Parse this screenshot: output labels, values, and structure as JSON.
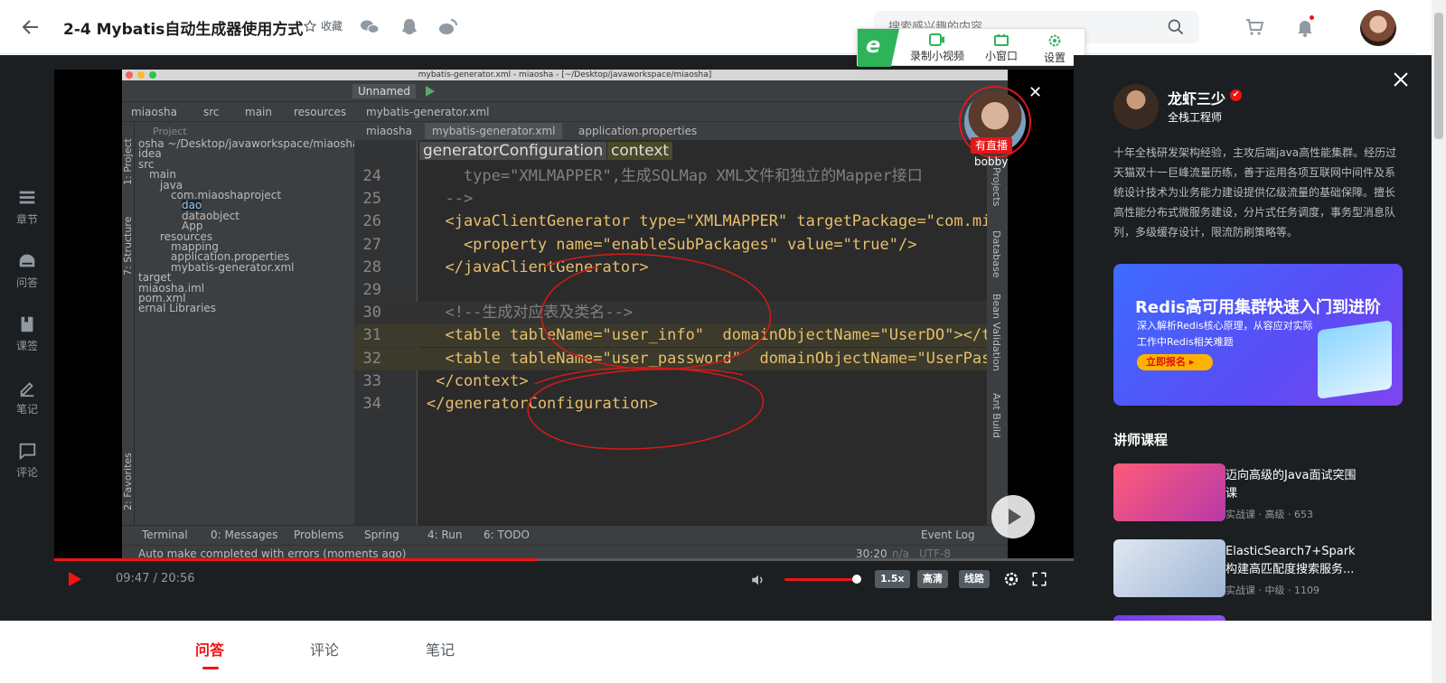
{
  "header": {
    "title": "2-4 Mybatis自动生成器使用方式",
    "favorite_label": "收藏",
    "search_placeholder": "搜索感兴趣的内容"
  },
  "float_bar": {
    "items": [
      {
        "label": "录制小视频",
        "icon": "video-record-icon"
      },
      {
        "label": "小窗口",
        "icon": "mini-window-icon"
      },
      {
        "label": "设置",
        "icon": "gear-icon"
      }
    ]
  },
  "left_nav": {
    "items": [
      {
        "label": "章节",
        "icon": "chapter-icon"
      },
      {
        "label": "问答",
        "icon": "qa-icon"
      },
      {
        "label": "课签",
        "icon": "bookmark-icon"
      },
      {
        "label": "笔记",
        "icon": "note-icon"
      },
      {
        "label": "评论",
        "icon": "comment-icon"
      }
    ]
  },
  "ide": {
    "window_title": "mybatis-generator.xml - miaosha - [~/Desktop/javaworkspace/miaosha]",
    "run_config": "Unnamed",
    "breadcrumbs": [
      "miaosha",
      "src",
      "main",
      "resources",
      "mybatis-generator.xml"
    ],
    "tabs": [
      "miaosha",
      "mybatis-generator.xml",
      "application.properties"
    ],
    "project_label": "Project",
    "tree": [
      "osha  ~/Desktop/javaworkspace/miaosha",
      "idea",
      "src",
      "main",
      "java",
      "com.miaoshaproject",
      "dao",
      "dataobject",
      "App",
      "resources",
      "mapping",
      "application.properties",
      "mybatis-generator.xml",
      "target",
      "miaosha.iml",
      "pom.xml",
      "ernal Libraries"
    ],
    "editor_crumbs": [
      "generatorConfiguration",
      "context"
    ],
    "code_lines": [
      {
        "n": "24",
        "text": "    type=\"XMLMAPPER\",生成SQLMap XML文件和独立的Mapper接口"
      },
      {
        "n": "25",
        "text": "  -->"
      },
      {
        "n": "26",
        "text": "  <javaClientGenerator type=\"XMLMAPPER\" targetPackage=\"com.mia"
      },
      {
        "n": "27",
        "text": "    <property name=\"enableSubPackages\" value=\"true\"/>"
      },
      {
        "n": "28",
        "text": "  </javaClientGenerator>"
      },
      {
        "n": "29",
        "text": ""
      },
      {
        "n": "30",
        "text": "  <!--生成对应表及类名-->"
      },
      {
        "n": "31",
        "text": "  <table tableName=\"user_info\"  domainObjectName=\"UserDO\"></t"
      },
      {
        "n": "32",
        "text": "  <table tableName=\"user_password\"  domainObjectName=\"UserPas"
      },
      {
        "n": "33",
        "text": " </context>"
      },
      {
        "n": "34",
        "text": "</generatorConfiguration>"
      }
    ],
    "side_left_tabs": [
      "1: Project",
      "7: Structure",
      "2: Favorites"
    ],
    "side_right_tabs": [
      "Projects",
      "Database",
      "Bean Validation",
      "Ant Build"
    ],
    "bottom_tools": [
      "Terminal",
      "0: Messages",
      "Problems",
      "Spring",
      "4: Run",
      "6: TODO"
    ],
    "event_log": "Event Log",
    "status_text": "Auto make completed with errors (moments ago)",
    "cursor_pos": "30:20",
    "na": "n/a",
    "encoding": "UTF-8"
  },
  "live": {
    "badge": "有直播",
    "name": "bobby"
  },
  "player": {
    "time": "09:47 / 20:56",
    "progress": 0.473,
    "volume": 0.95,
    "speed": "1.5x",
    "quality": "高清",
    "line": "线路"
  },
  "teacher": {
    "name": "龙虾三少",
    "title": "全栈工程师",
    "bio": "十年全栈研发架构经验，主攻后端java高性能集群。经历过天猫双十一巨峰流量历练，善于运用各项互联网中间件及系统设计技术为业务能力建设提供亿级流量的基础保障。擅长高性能分布式微服务建设，分片式任务调度，事务型消息队列，多级缓存设计，限流防刷策略等。"
  },
  "banner": {
    "title": "Redis高可用集群快速入门到进阶",
    "sub1": "深入解析Redis核心原理，从容应对实际",
    "sub2": "工作中Redis相关难题",
    "button": "立即报名"
  },
  "courses": {
    "heading": "讲师课程",
    "items": [
      {
        "title": "迈向高级的Java面试突围课",
        "meta": "实战课 · 高级 · 653"
      },
      {
        "title": "ElasticSearch7+Spark构建高匹配度搜索服务...",
        "meta": "实战课 · 中级 · 1109"
      },
      {
        "title": "",
        "meta": ""
      }
    ]
  },
  "bottom_tabs": [
    "问答",
    "评论",
    "笔记"
  ]
}
